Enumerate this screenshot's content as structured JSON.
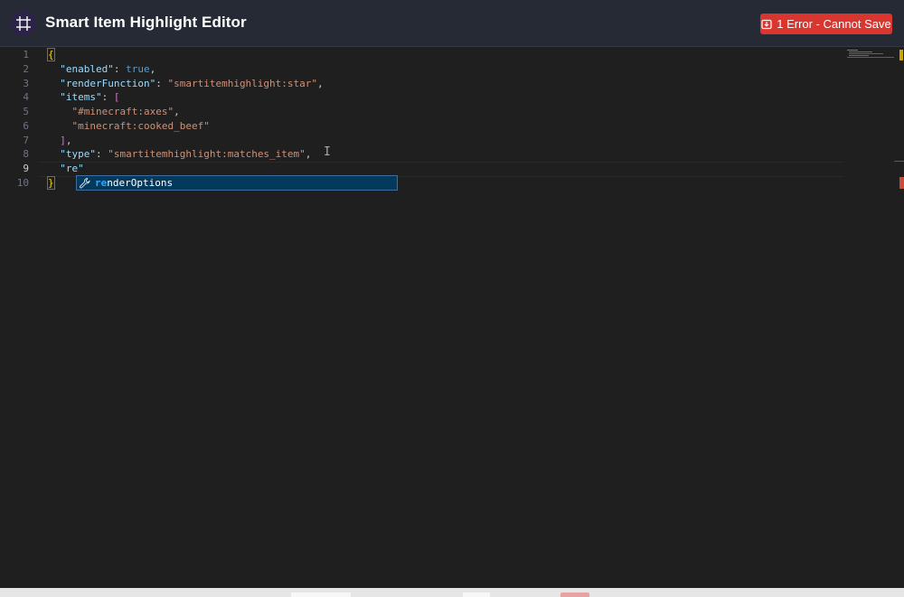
{
  "app": {
    "title": "Smart Item Highlight Editor",
    "logo_icon": "crop-frame-icon"
  },
  "header": {
    "error_button_label": "1 Error - Cannot Save",
    "error_button_icon": "save-icon",
    "error_color": "#d9362f"
  },
  "editor": {
    "active_line": 9,
    "line_numbers": [
      "1",
      "2",
      "3",
      "4",
      "5",
      "6",
      "7",
      "8",
      "9",
      "10"
    ],
    "lines": {
      "l1": {
        "open": "{"
      },
      "l2": {
        "key": "\"enabled\"",
        "sep": ": ",
        "value": "true",
        "end": ","
      },
      "l3": {
        "key": "\"renderFunction\"",
        "sep": ": ",
        "value": "\"smartitemhighlight:star\"",
        "end": ","
      },
      "l4": {
        "key": "\"items\"",
        "sep": ": ",
        "open": "["
      },
      "l5": {
        "value": "\"#minecraft:axes\"",
        "end": ","
      },
      "l6": {
        "value": "\"minecraft:cooked_beef\""
      },
      "l7": {
        "close": "]",
        "end": ","
      },
      "l8": {
        "key": "\"type\"",
        "sep": ": ",
        "value": "\"smartitemhighlight:matches_item\"",
        "end": ","
      },
      "l9": {
        "partial": "\"re\""
      },
      "l10": {
        "close": "}"
      }
    }
  },
  "suggestion": {
    "icon": "wrench-icon",
    "match": "re",
    "rest": "nderOptions"
  }
}
